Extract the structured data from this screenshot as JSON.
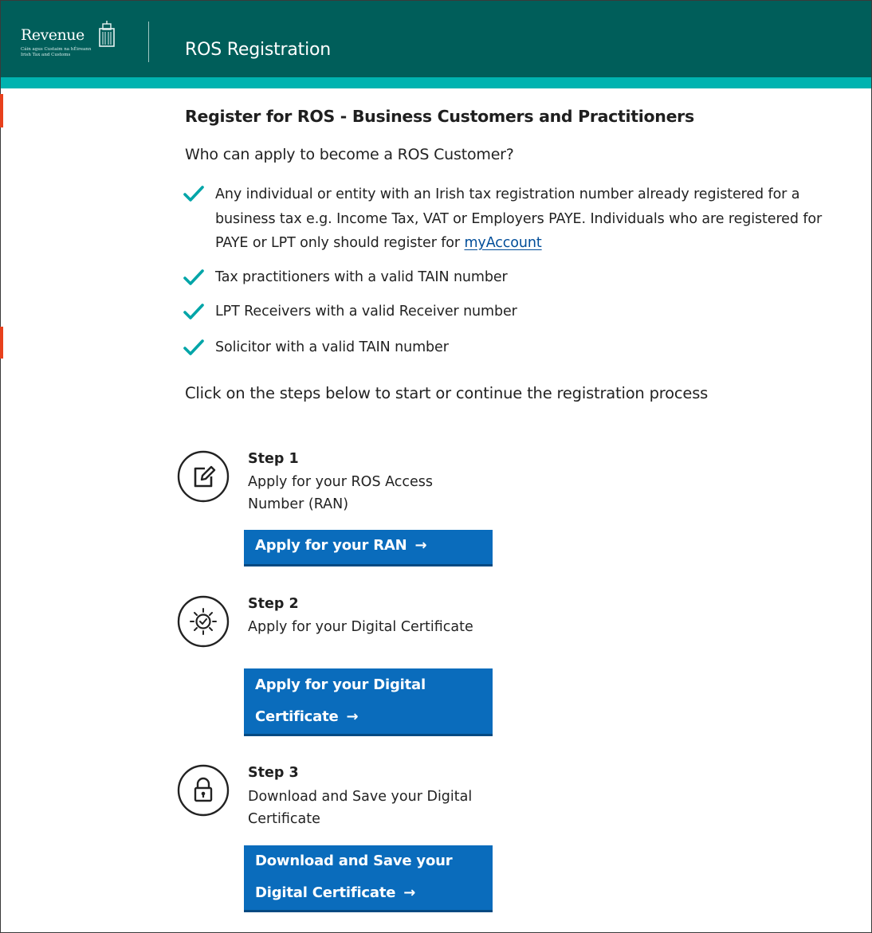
{
  "header": {
    "logo_text": "Revenue",
    "logo_subtext": [
      "Cáin agus Custaim na hÉireann",
      "Irish Tax and Customs"
    ],
    "app_title": "ROS Registration"
  },
  "main": {
    "heading": "Register for ROS - Business Customers and Practitioners",
    "intro": "Who can apply to become a ROS Customer?",
    "eligibility": [
      {
        "text": "Any individual or entity with an Irish tax registration number already registered for a business tax e.g. Income Tax, VAT or Employers PAYE. Individuals who are registered for PAYE or LPT only should register for ",
        "link_text": "myAccount"
      },
      {
        "text": "Tax practitioners with a valid TAIN number"
      },
      {
        "text": "LPT Receivers with a valid Receiver number"
      },
      {
        "text": "Solicitor with a valid TAIN number"
      }
    ],
    "instruction": "Click on the steps below to start or continue the registration process",
    "steps": [
      {
        "label": "Step 1",
        "description": "Apply for your ROS Access Number (RAN)",
        "button_lines": [
          "Apply for your RAN"
        ],
        "icon": "edit-icon"
      },
      {
        "label": "Step 2",
        "description": "Apply for your Digital Certificate",
        "button_lines": [
          "Apply for your Digital",
          "Certificate"
        ],
        "icon": "certificate-icon"
      },
      {
        "label": "Step 3",
        "description": "Download and Save your Digital Certificate",
        "button_lines": [
          "Download and Save your",
          "Digital Certificate"
        ],
        "icon": "lock-icon"
      }
    ],
    "arrow_glyph": "→"
  },
  "colors": {
    "header_bg": "#005e5a",
    "header_stripe": "#00b3b0",
    "button_bg": "#0a6cbc",
    "check": "#00a5a8",
    "link": "#004d99"
  }
}
